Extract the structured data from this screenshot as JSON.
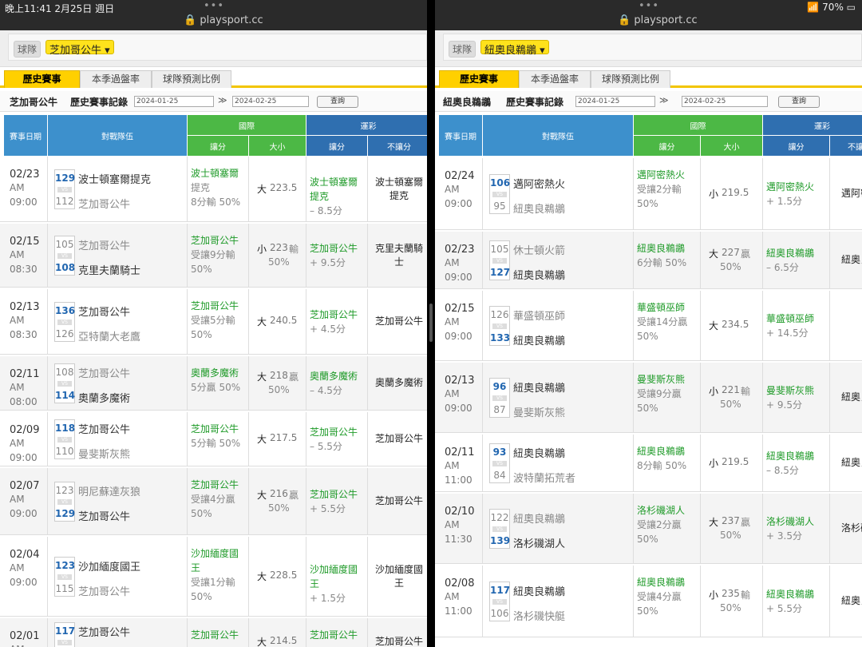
{
  "status": {
    "time": "晚上11:41  2月25日 週日",
    "battery": "70%",
    "dots": "•••"
  },
  "url": "playsport.cc",
  "left": {
    "team_label": "球隊",
    "team_select": "芝加哥公牛 ▾",
    "tabs": [
      "歷史賽事",
      "本季過盤率",
      "球隊預測比例"
    ],
    "rec_team": "芝加哥公牛",
    "rec_title": "歷史賽事記錄",
    "date_from": "2024-01-25",
    "date_to": "2024-02-25",
    "query": "查詢",
    "headers": {
      "date": "賽事日期",
      "matchup": "對戰隊伍",
      "intl": "國際",
      "spread": "讓分",
      "ou": "大小",
      "lottery": "運彩",
      "nospread": "不讓分"
    },
    "rows": [
      {
        "md": "02/23",
        "ap": "AM",
        "hm": "09:00",
        "s1": "129",
        "t1": "波士頓塞爾提克",
        "s2": "112",
        "t2": "芝加哥公牛",
        "w": 1,
        "sp1": "波士頓塞爾",
        "sp2": "提克",
        "sp3": "8分輸 50%",
        "ob": "大",
        "on": "223.5",
        "or": "",
        "op": "",
        "lt1": "波士頓塞爾",
        "lt2": "提克",
        "lt3": "– 8.5分",
        "nb1": "波士頓塞爾",
        "nb2": "提克"
      },
      {
        "md": "02/15",
        "ap": "AM",
        "hm": "08:30",
        "s1": "105",
        "t1": "芝加哥公牛",
        "s2": "108",
        "t2": "克里夫蘭騎士",
        "w": 2,
        "sp1": "芝加哥公牛",
        "sp2": "受讓9分輸",
        "sp3": "50%",
        "ob": "小",
        "on": "223",
        "or": "輸",
        "op": "50%",
        "lt1": "芝加哥公牛",
        "lt2": "",
        "lt3": "+ 9.5分",
        "nb1": "克里夫蘭騎",
        "nb2": "士"
      },
      {
        "md": "02/13",
        "ap": "AM",
        "hm": "08:30",
        "s1": "136",
        "t1": "芝加哥公牛",
        "s2": "126",
        "t2": "亞特蘭大老鷹",
        "w": 1,
        "sp1": "芝加哥公牛",
        "sp2": "受讓5分輸",
        "sp3": "50%",
        "ob": "大",
        "on": "240.5",
        "or": "",
        "op": "",
        "lt1": "芝加哥公牛",
        "lt2": "",
        "lt3": "+ 4.5分",
        "nb1": "芝加哥公牛",
        "nb2": ""
      },
      {
        "md": "02/11",
        "ap": "AM",
        "hm": "08:00",
        "s1": "108",
        "t1": "芝加哥公牛",
        "s2": "114",
        "t2": "奧蘭多魔術",
        "w": 2,
        "sp1": "奧蘭多魔術",
        "sp2": "5分贏 50%",
        "sp3": "",
        "ob": "大",
        "on": "218",
        "or": "贏",
        "op": "50%",
        "lt1": "奧蘭多魔術",
        "lt2": "",
        "lt3": "– 4.5分",
        "nb1": "奧蘭多魔術",
        "nb2": ""
      },
      {
        "md": "02/09",
        "ap": "AM",
        "hm": "09:00",
        "s1": "118",
        "t1": "芝加哥公牛",
        "s2": "110",
        "t2": "曼斐斯灰熊",
        "w": 1,
        "sp1": "芝加哥公牛",
        "sp2": "5分輸 50%",
        "sp3": "",
        "ob": "大",
        "on": "217.5",
        "or": "",
        "op": "",
        "lt1": "芝加哥公牛",
        "lt2": "",
        "lt3": "– 5.5分",
        "nb1": "芝加哥公牛",
        "nb2": ""
      },
      {
        "md": "02/07",
        "ap": "AM",
        "hm": "09:00",
        "s1": "123",
        "t1": "明尼蘇達灰狼",
        "s2": "129",
        "t2": "芝加哥公牛",
        "w": 2,
        "sp1": "芝加哥公牛",
        "sp2": "受讓4分贏",
        "sp3": "50%",
        "ob": "大",
        "on": "216",
        "or": "贏",
        "op": "50%",
        "lt1": "芝加哥公牛",
        "lt2": "",
        "lt3": "+ 5.5分",
        "nb1": "芝加哥公牛",
        "nb2": ""
      },
      {
        "md": "02/04",
        "ap": "AM",
        "hm": "09:00",
        "s1": "123",
        "t1": "沙加緬度國王",
        "s2": "115",
        "t2": "芝加哥公牛",
        "w": 1,
        "sp1": "沙加緬度國",
        "sp2": "王",
        "sp3": "受讓1分輸",
        "sp4": "50%",
        "ob": "大",
        "on": "228.5",
        "or": "",
        "op": "",
        "lt1": "沙加緬度國",
        "lt2": "王",
        "lt3": "+ 1.5分",
        "nb1": "沙加緬度國",
        "nb2": "王"
      },
      {
        "md": "02/01",
        "ap": "AM",
        "hm": "",
        "s1": "117",
        "t1": "芝加哥公牛",
        "s2": "",
        "t2": "",
        "w": 1,
        "sp1": "芝加哥公牛",
        "sp2": "",
        "sp3": "",
        "ob": "大",
        "on": "214.5",
        "or": "",
        "op": "",
        "lt1": "芝加哥公牛",
        "lt2": "",
        "lt3": "",
        "nb1": "芝加哥公牛",
        "nb2": ""
      }
    ]
  },
  "right": {
    "team_label": "球隊",
    "team_select": "紐奧良鵜鶘 ▾",
    "tabs": [
      "歷史賽事",
      "本季過盤率",
      "球隊預測比例"
    ],
    "rec_team": "紐奧良鵜鶘",
    "rec_title": "歷史賽事記錄",
    "date_from": "2024-01-25",
    "date_to": "2024-02-25",
    "query": "查詢",
    "headers": {
      "date": "賽事日期",
      "matchup": "對戰隊伍",
      "intl": "國際",
      "spread": "讓分",
      "ou": "大小",
      "lottery": "運彩",
      "nospread": "不讓"
    },
    "rows": [
      {
        "md": "02/24",
        "ap": "AM",
        "hm": "09:00",
        "s1": "106",
        "t1": "邁阿密熱火",
        "s2": "95",
        "t2": "紐奧良鵜鶘",
        "w": 1,
        "sp1": "邁阿密熱火",
        "sp2": "受讓2分輸",
        "sp3": "50%",
        "ob": "小",
        "on": "219.5",
        "or": "",
        "op": "",
        "lt1": "邁阿密熱火",
        "lt2": "",
        "lt3": "+ 1.5分",
        "nb1": "邁阿密",
        "nb2": ""
      },
      {
        "md": "02/23",
        "ap": "AM",
        "hm": "09:00",
        "s1": "105",
        "t1": "休士頓火箭",
        "s2": "127",
        "t2": "紐奧良鵜鶘",
        "w": 2,
        "sp1": "紐奧良鵜鶘",
        "sp2": "6分輸 50%",
        "sp3": "",
        "ob": "大",
        "on": "227",
        "or": "贏",
        "op": "50%",
        "lt1": "紐奧良鵜鶘",
        "lt2": "",
        "lt3": "– 6.5分",
        "nb1": "紐奧良",
        "nb2": ""
      },
      {
        "md": "02/15",
        "ap": "AM",
        "hm": "09:00",
        "s1": "126",
        "t1": "華盛頓巫師",
        "s2": "133",
        "t2": "紐奧良鵜鶘",
        "w": 2,
        "sp1": "華盛頓巫師",
        "sp2": "受讓14分贏",
        "sp3": "50%",
        "ob": "大",
        "on": "234.5",
        "or": "",
        "op": "",
        "lt1": "華盛頓巫師",
        "lt2": "",
        "lt3": "+ 14.5分",
        "nb1": "",
        "nb2": ""
      },
      {
        "md": "02/13",
        "ap": "AM",
        "hm": "09:00",
        "s1": "96",
        "t1": "紐奧良鵜鶘",
        "s2": "87",
        "t2": "曼斐斯灰熊",
        "w": 1,
        "sp1": "曼斐斯灰熊",
        "sp2": "受讓9分贏",
        "sp3": "50%",
        "ob": "小",
        "on": "221",
        "or": "輸",
        "op": "50%",
        "lt1": "曼斐斯灰熊",
        "lt2": "",
        "lt3": "+ 9.5分",
        "nb1": "紐奧良",
        "nb2": ""
      },
      {
        "md": "02/11",
        "ap": "AM",
        "hm": "11:00",
        "s1": "93",
        "t1": "紐奧良鵜鶘",
        "s2": "84",
        "t2": "波特蘭拓荒者",
        "w": 1,
        "sp1": "紐奧良鵜鶘",
        "sp2": "8分輸 50%",
        "sp3": "",
        "ob": "小",
        "on": "219.5",
        "or": "",
        "op": "",
        "lt1": "紐奧良鵜鶘",
        "lt2": "",
        "lt3": "– 8.5分",
        "nb1": "紐奧良",
        "nb2": ""
      },
      {
        "md": "02/10",
        "ap": "AM",
        "hm": "11:30",
        "s1": "122",
        "t1": "紐奧良鵜鶘",
        "s2": "139",
        "t2": "洛杉磯湖人",
        "w": 2,
        "sp1": "洛杉磯湖人",
        "sp2": "受讓2分贏",
        "sp3": "50%",
        "ob": "大",
        "on": "237",
        "or": "贏",
        "op": "50%",
        "lt1": "洛杉磯湖人",
        "lt2": "",
        "lt3": "+ 3.5分",
        "nb1": "洛杉磯",
        "nb2": ""
      },
      {
        "md": "02/08",
        "ap": "AM",
        "hm": "11:00",
        "s1": "117",
        "t1": "紐奧良鵜鶘",
        "s2": "106",
        "t2": "洛杉磯快艇",
        "w": 1,
        "sp1": "紐奧良鵜鶘",
        "sp2": "受讓4分贏",
        "sp3": "50%",
        "ob": "小",
        "on": "235",
        "or": "輸",
        "op": "50%",
        "lt1": "紐奧良鵜鶘",
        "lt2": "",
        "lt3": "+ 5.5分",
        "nb1": "紐奧良",
        "nb2": ""
      }
    ]
  }
}
